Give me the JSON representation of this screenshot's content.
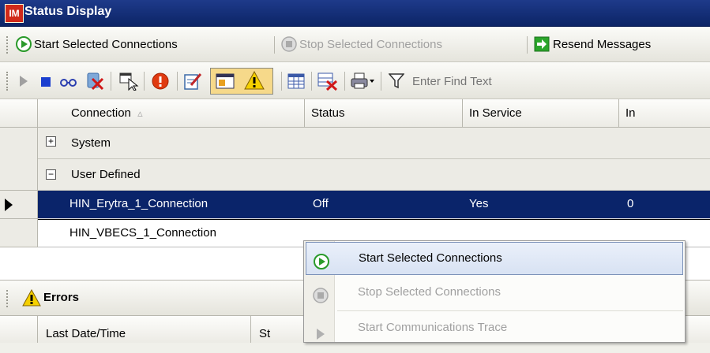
{
  "window": {
    "logo": "IM",
    "title": "Status Display"
  },
  "toolbar1": {
    "start_label": "Start Selected Connections",
    "stop_label": "Stop Selected Connections",
    "resend_label": "Resend Messages"
  },
  "toolbar2": {
    "find_placeholder": "Enter Find Text",
    "icons": [
      "play-icon",
      "stop-square-icon",
      "binoculars-icon",
      "delete-icon",
      "select-window-icon",
      "error-icon",
      "edit-icon",
      "properties-icon",
      "warning-icon",
      "grid-icon",
      "remove-grid-icon",
      "print-icon",
      "filter-icon"
    ]
  },
  "grid": {
    "columns": [
      "Connection",
      "Status",
      "In Service",
      "In"
    ],
    "sort_indicator": "▵",
    "groups": [
      {
        "expander": "+",
        "label": "System"
      },
      {
        "expander": "−",
        "label": "User Defined"
      }
    ],
    "rows": [
      {
        "connection": "HIN_Erytra_1_Connection",
        "status": "Off",
        "in_service": "Yes",
        "in": "0",
        "selected": true
      },
      {
        "connection": "HIN_VBECS_1_Connection",
        "status": "",
        "in_service": "",
        "in": "",
        "selected": false
      }
    ]
  },
  "errors_pane": {
    "title": "Errors",
    "col_partial": "Last Date/Time",
    "col2_partial": "St"
  },
  "context_menu": {
    "items": [
      {
        "label": "Start Selected Connections",
        "enabled": true,
        "highlighted": true
      },
      {
        "label": "Stop Selected Connections",
        "enabled": false
      },
      {
        "label": "Start Communications Trace",
        "enabled": false
      }
    ]
  },
  "colors": {
    "titlebar": "#1e3a8a",
    "selection": "#0a246a",
    "accent_green": "#2a9a2a"
  }
}
